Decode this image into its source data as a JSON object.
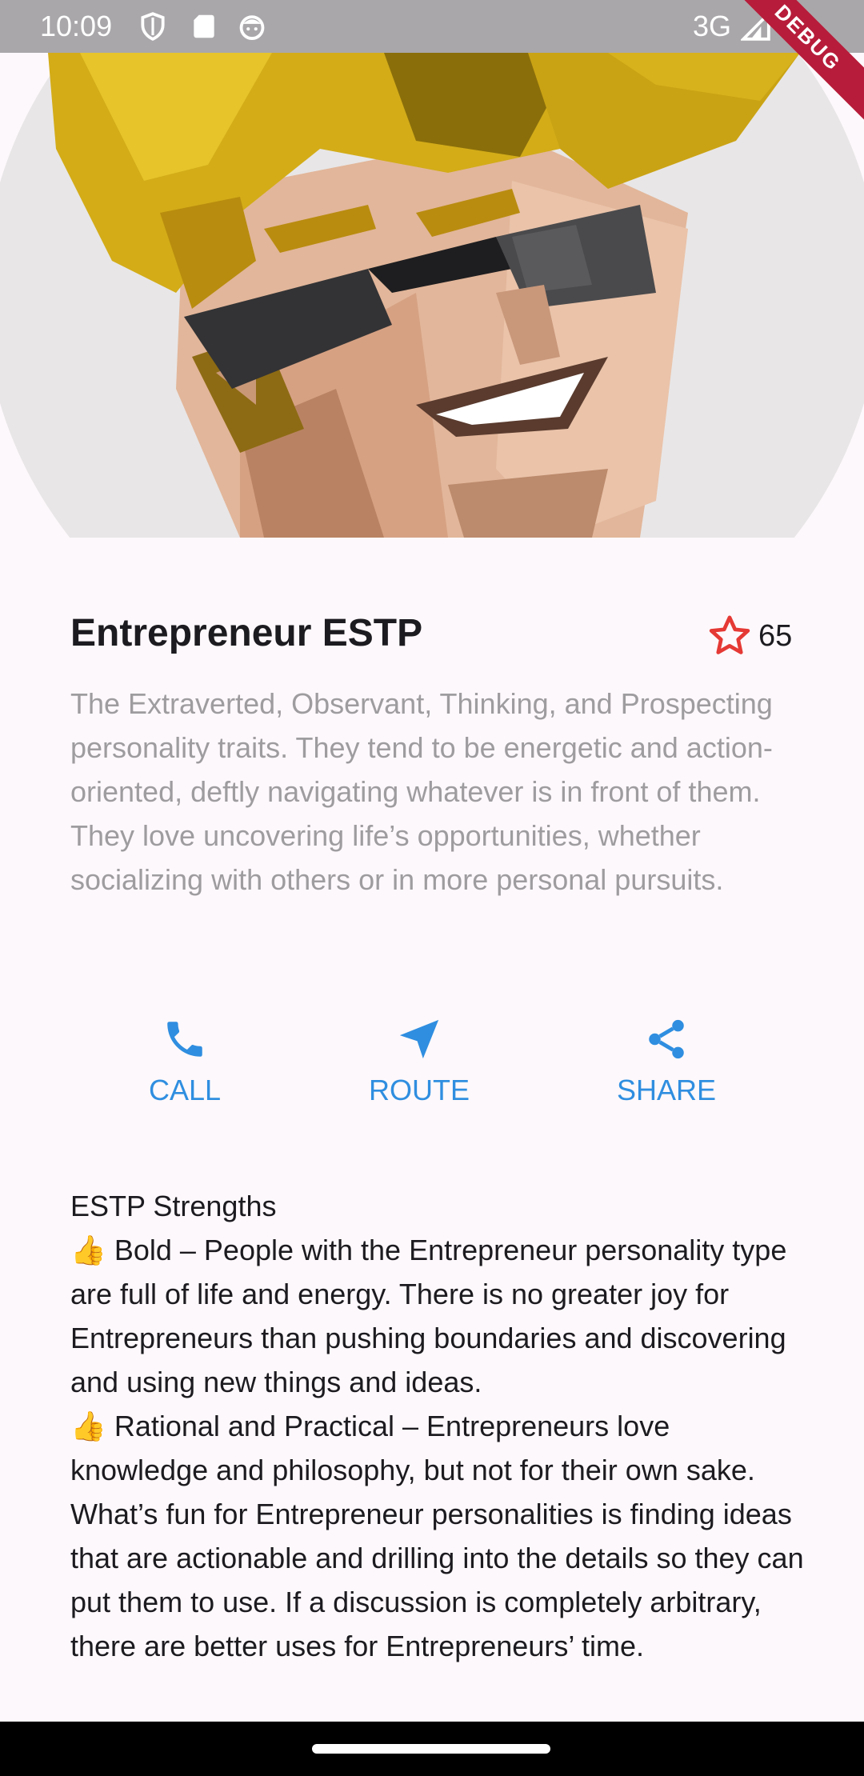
{
  "status_bar": {
    "time": "10:09",
    "network": "3G",
    "icons": [
      "shield-icon",
      "sd-card-icon",
      "face-icon",
      "signal-icon",
      "battery-icon"
    ],
    "debug_label": "DEBUG"
  },
  "hero": {
    "image": "entrepreneur-avatar-illustration"
  },
  "header": {
    "title": "Entrepreneur ESTP",
    "favorite_icon": "star-outline-icon",
    "favorite_count": "65",
    "favorite_color": "#e53935"
  },
  "description": "The Extraverted, Observant, Thinking, and Prospecting personality traits. They tend to be energetic and action-oriented, deftly navigating whatever is in front of them. They love uncovering life’s opportunities, whether socializing with others or in more personal pursuits.",
  "actions": {
    "color": "#2f8ee0",
    "call": {
      "label": "CALL",
      "icon": "phone-icon"
    },
    "route": {
      "label": "ROUTE",
      "icon": "navigation-icon"
    },
    "share": {
      "label": "SHARE",
      "icon": "share-icon"
    }
  },
  "strengths": {
    "heading": "ESTP Strengths",
    "items": [
      "👍 Bold – People with the Entrepreneur personality type are full of life and energy. There is no greater joy for Entrepreneurs than pushing boundaries and discovering and using new things and ideas.",
      "👍 Rational and Practical – Entrepreneurs love knowledge and philosophy, but not for their own sake. What’s fun for Entrepreneur personalities is finding ideas that are actionable and drilling into the details so they can put them to use. If a discussion is completely arbitrary, there are better uses for Entrepreneurs’ time."
    ]
  }
}
